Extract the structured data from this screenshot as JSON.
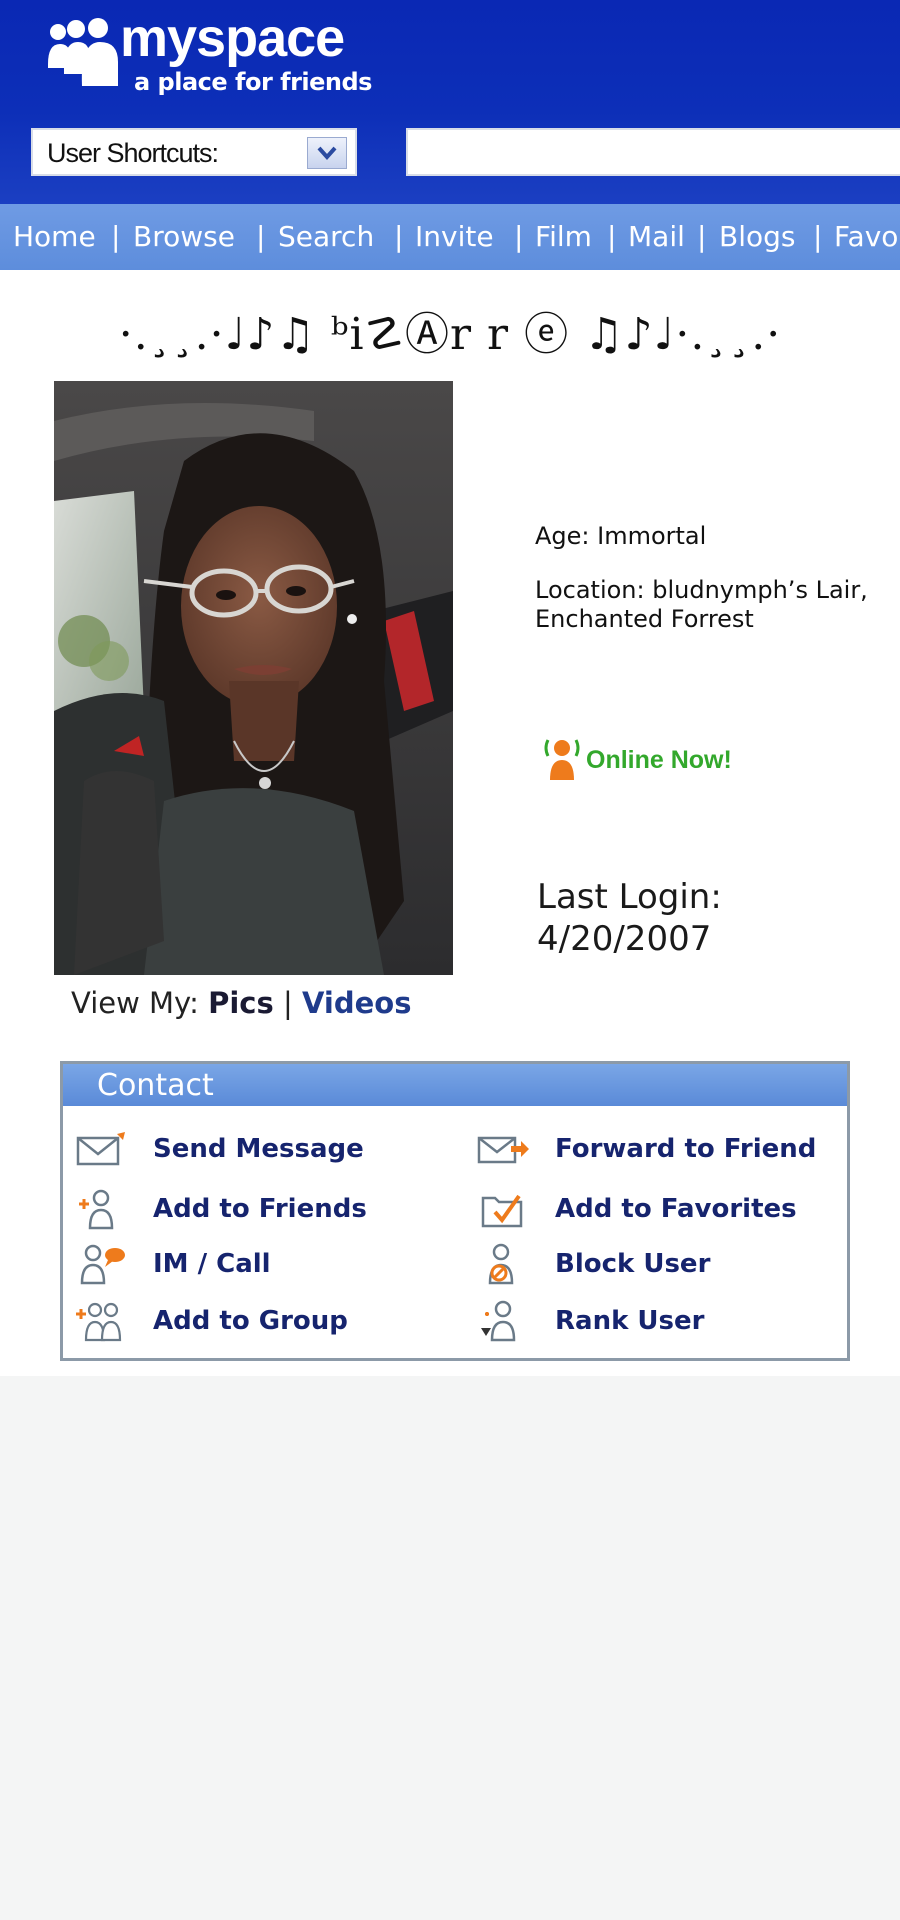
{
  "brand": {
    "name": "myspace",
    "tagline": "a place for friends"
  },
  "header": {
    "shortcuts_label": "User Shortcuts:",
    "search_value": ""
  },
  "nav": {
    "items": [
      "Home",
      "Browse",
      "Search",
      "Invite",
      "Film",
      "Mail",
      "Blogs",
      "Favo"
    ]
  },
  "profile": {
    "display_name": "·.¸¸.·♩♪♫ ᵇi☡Ⓐr r ⓔ ♫♪♩·.¸¸.·",
    "age": "Age: Immortal",
    "location_line1": "Location: bludnymph’s Lair,",
    "location_line2": "Enchanted Forrest",
    "online_status": "Online Now!",
    "last_login_label": "Last Login:",
    "last_login_date": "4/20/2007",
    "view_my_label": "View My:",
    "view_pics": "Pics",
    "view_sep": "|",
    "view_videos": "Videos"
  },
  "contact": {
    "title": "Contact",
    "items": [
      {
        "label": "Send Message",
        "icon": "envelope-icon"
      },
      {
        "label": "Forward to Friend",
        "icon": "forward-envelope-icon"
      },
      {
        "label": "Add to Friends",
        "icon": "add-friend-icon"
      },
      {
        "label": "Add to Favorites",
        "icon": "favorites-folder-icon"
      },
      {
        "label": "IM / Call",
        "icon": "im-call-icon"
      },
      {
        "label": "Block User",
        "icon": "block-user-icon"
      },
      {
        "label": "Add to Group",
        "icon": "add-group-icon"
      },
      {
        "label": "Rank User",
        "icon": "rank-user-icon"
      }
    ]
  },
  "colors": {
    "header_blue": "#0a28b4",
    "nav_blue": "#6f9be4",
    "online_green": "#33a82c",
    "link_navy": "#16246e"
  }
}
